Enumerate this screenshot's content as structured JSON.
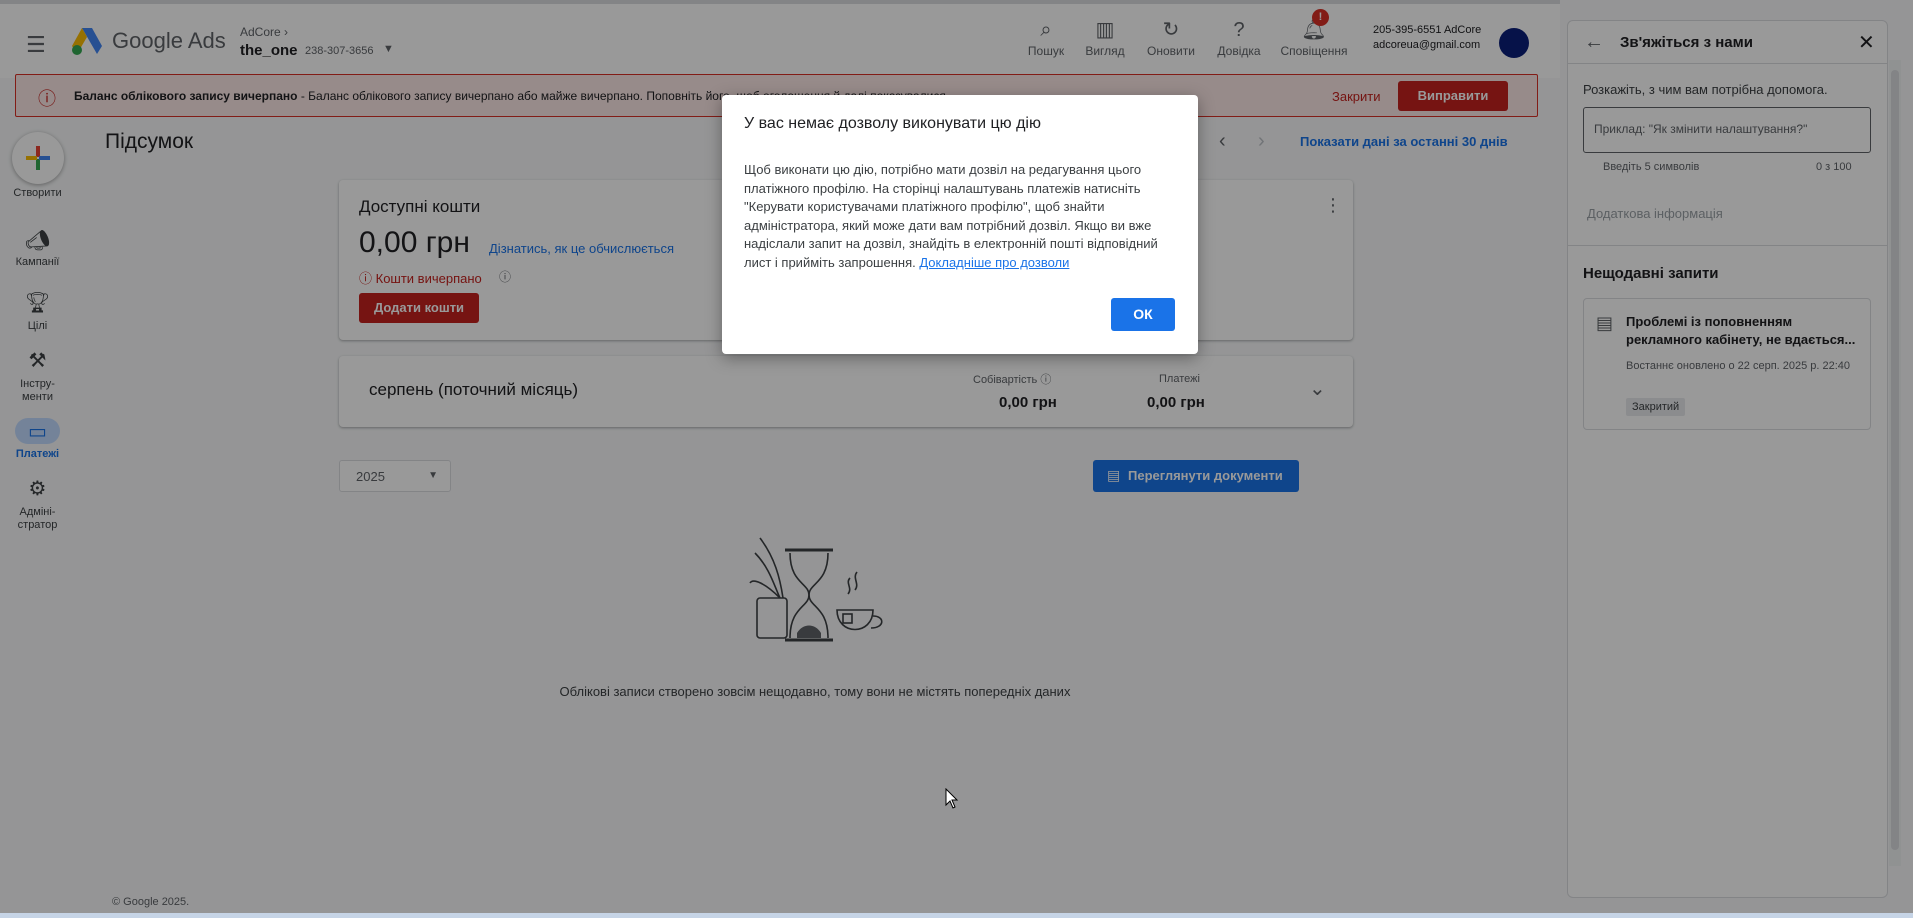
{
  "topbar": {
    "product_name": "Google Ads",
    "account_parent": "AdCore",
    "account_name": "the_one",
    "account_id": "238-307-3656",
    "buttons": [
      {
        "label": "Пошук",
        "icon": "search-icon"
      },
      {
        "label": "Вигляд",
        "icon": "view-icon"
      },
      {
        "label": "Оновити",
        "icon": "refresh-icon"
      },
      {
        "label": "Довідка",
        "icon": "help-icon"
      },
      {
        "label": "Сповіщення",
        "icon": "notifications-icon"
      }
    ],
    "notification_badge": "!",
    "user_line1": "205-395-6551 AdCore",
    "user_line2": "adcoreua@gmail.com"
  },
  "banner": {
    "title": "Баланс облікового запису вичерпано",
    "text": " - Баланс облікового запису вичерпано або майже вичерпано. Поповніть його, щоб оголошення й далі показувалися.",
    "close_label": "Закрити",
    "fix_label": "Виправити"
  },
  "leftnav": {
    "create_label": "Створити",
    "items": [
      {
        "label": "Кампанії",
        "icon": "campaigns-icon"
      },
      {
        "label": "Цілі",
        "icon": "goals-icon"
      },
      {
        "label_line1": "Інстру-",
        "label_line2": "менти",
        "icon": "tools-icon"
      },
      {
        "label": "Платежі",
        "icon": "billing-icon"
      },
      {
        "label_line1": "Адміні-",
        "label_line2": "стратор",
        "icon": "admin-icon"
      }
    ]
  },
  "main": {
    "page_title": "Підсумок",
    "date_range_label": "Показати дані за останні 30 днів",
    "funds_card": {
      "title": "Доступні кошти",
      "amount": "0,00 грн",
      "learn_link": "Дізнатись, як це обчислюється",
      "warning": "Кошти вичерпано",
      "add_button": "Додати кошти"
    },
    "month_card": {
      "title": "серпень (поточний місяць)",
      "cost_label": "Собівартість",
      "cost_value": "0,00 грн",
      "payments_label": "Платежі",
      "payments_value": "0,00 грн"
    },
    "year_value": "2025",
    "docs_button": "Переглянути документи",
    "empty_text": "Облікові записи створено зовсім нещодавно, тому вони не містять попередніх даних"
  },
  "footer": "© Google 2025.",
  "right_panel": {
    "title": "Зв'яжіться з нами",
    "prompt": "Розкажіть, з чим вам потрібна допомога.",
    "input_placeholder": "Приклад: \"Як змінити налаштування?\"",
    "hint": "Введіть 5 символів",
    "counter": "0 з 100",
    "extra_info": "Додаткова інформація",
    "recent_title": "Нещодавні запити",
    "request": {
      "title": "Проблемі із поповненням рекламного кабінету, не вдається...",
      "updated": "Востаннє оновлено о 22 серп. 2025 р. 22:40",
      "status": "Закритий"
    }
  },
  "dialog": {
    "title": "У вас немає дозволу виконувати цю дію",
    "body": "Щоб виконати цю дію, потрібно мати дозвіл на редагування цього платіжного профілю. На сторінці налаштувань платежів натисніть \"Керувати користувачами платіжного профілю\", щоб знайти адміністратора, який може дати вам потрібний дозвіл. Якщо ви вже надіслали запит на дозвіл, знайдіть в електронній пошті відповідний лист і прийміть запрошення. ",
    "link": "Докладніше про дозволи",
    "ok_label": "ОК"
  },
  "colors": {
    "primary": "#1a73e8",
    "error": "#c5221f",
    "scrim": "rgba(0,0,0,0.4)"
  }
}
